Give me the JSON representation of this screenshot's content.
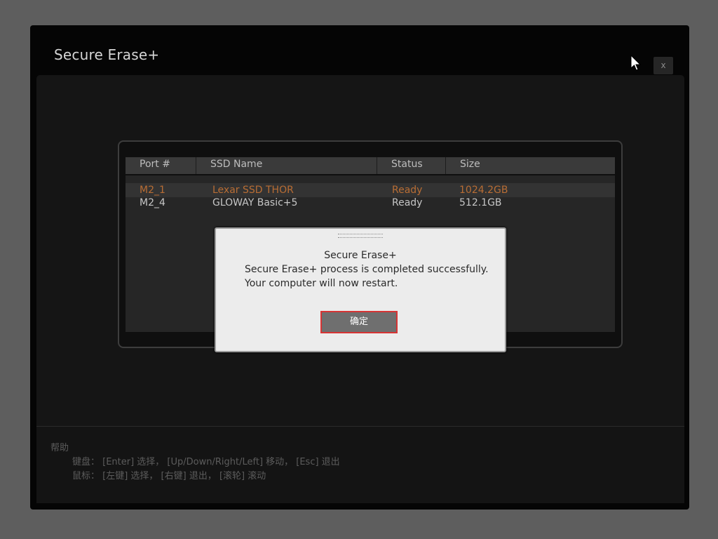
{
  "window": {
    "title": "Secure Erase+",
    "close_label": "x"
  },
  "table": {
    "headers": [
      "Port #",
      "SSD Name",
      "Status",
      "Size"
    ],
    "rows": [
      {
        "port": "M2_1",
        "name": "Lexar SSD THOR",
        "status": "Ready",
        "size": "1024.2GB",
        "selected": true
      },
      {
        "port": "M2_4",
        "name": "GLOWAY Basic+5",
        "status": "Ready",
        "size": "512.1GB",
        "selected": false
      }
    ]
  },
  "dialog": {
    "title": "Secure Erase+",
    "message_line1": "Secure Erase+ process is completed successfully.",
    "message_line2": "Your computer will now restart.",
    "ok_label": "确定"
  },
  "help": {
    "title": "帮助",
    "keyboard": "键盘： [Enter] 选择， [Up/Down/Right/Left] 移动， [Esc] 退出",
    "mouse": "鼠标： [左键] 选择， [右键] 退出， [滚轮] 滚动"
  },
  "colors": {
    "selected_row_text": "#b86d34",
    "ok_button_border": "#d63434"
  }
}
